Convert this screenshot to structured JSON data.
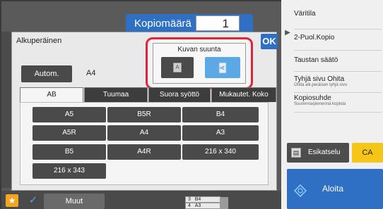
{
  "header": {
    "copies_label": "Kopiomäärä",
    "copies_value": "1"
  },
  "dialog": {
    "title": "Alkuperäinen",
    "ok_label": "OK",
    "auto_label": "Autom.",
    "selected_size": "A4",
    "orientation": {
      "title": "Kuvan suunta",
      "portrait_glyph": "A",
      "landscape_glyph": "A",
      "selected": "landscape"
    },
    "tabs": [
      {
        "label": "AB",
        "active": true
      },
      {
        "label": "Tuumaa",
        "active": false
      },
      {
        "label": "Suora syöttö",
        "active": false
      },
      {
        "label": "Mukautet. Koko",
        "active": false
      }
    ],
    "sizes": [
      "A5",
      "B5R",
      "B4",
      "A5R",
      "A4",
      "A3",
      "B5",
      "A4R",
      "216 x 340",
      "216 x 343"
    ]
  },
  "bottom": {
    "star_glyph": "★",
    "check_glyph": "✓",
    "other_label": "Muut",
    "trays": [
      {
        "num": "3",
        "size": "B4"
      },
      {
        "num": "4",
        "size": "A3"
      }
    ]
  },
  "right_panel": {
    "arrow_glyph": "▶",
    "items": [
      {
        "title": "Väritila",
        "sub": ""
      },
      {
        "title": "2-Puol.Kopio",
        "sub": ""
      },
      {
        "title": "Taustan säätö",
        "sub": ""
      },
      {
        "title": "Tyhjä sivu Ohita",
        "sub": "Ohita alk.peräisen tyhjä sivu"
      },
      {
        "title": "Kopiosuhde",
        "sub": "Suurenna/pienennä kopiota"
      }
    ],
    "preview_label": "Esikatselu",
    "ca_label": "CA",
    "start_label": "Aloita"
  },
  "colors": {
    "accent_blue": "#2f6fc4",
    "highlight_red": "#e0243a",
    "selected_light_blue": "#5ba8e6",
    "ca_yellow": "#f5c518",
    "star_orange": "#f0a61e"
  }
}
